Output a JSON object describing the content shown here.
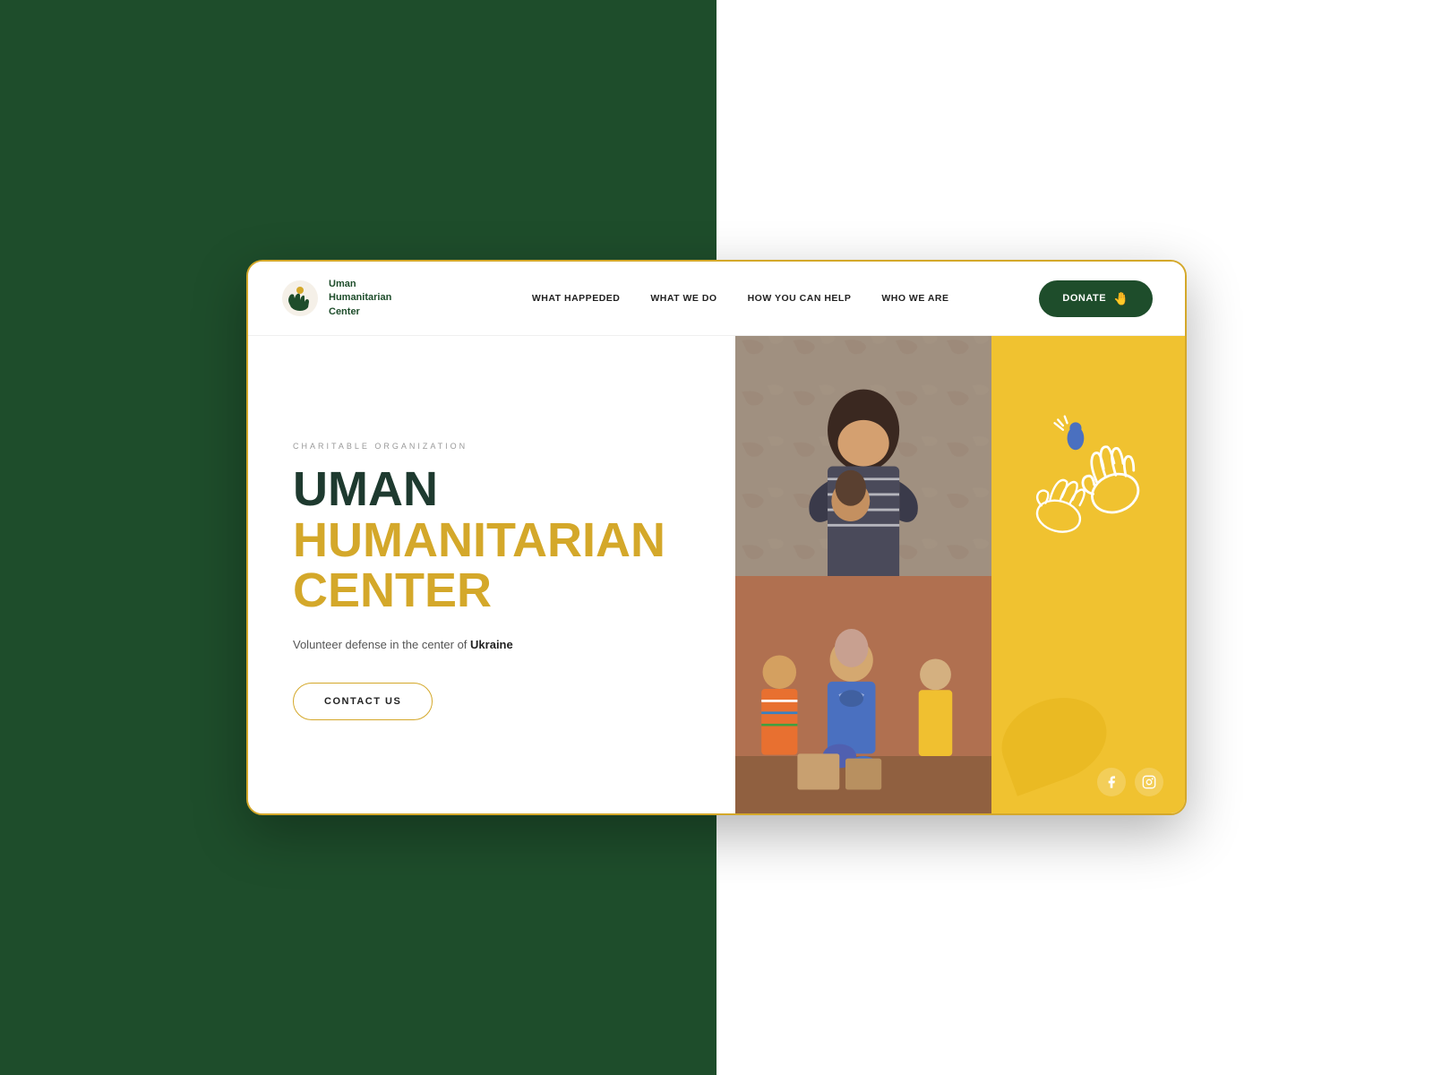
{
  "meta": {
    "bg_left": "#1e4d2b",
    "bg_right": "#ffffff"
  },
  "navbar": {
    "logo_line1": "Uman",
    "logo_line2": "Humanitarian",
    "logo_line3": "Center",
    "nav_items": [
      {
        "id": "what-happened",
        "label": "WHAT HAPPEDED"
      },
      {
        "id": "what-we-do",
        "label": "WHAT WE DO"
      },
      {
        "id": "how-you-can-help",
        "label": "HOW YOU CAN HELP"
      },
      {
        "id": "who-we-are",
        "label": "WHO WE ARE"
      }
    ],
    "donate_label": "DONATE",
    "donate_icon": "🤚"
  },
  "hero": {
    "charity_label": "CHARITABLE ORGANIZATION",
    "title_dark": "UMAN",
    "title_yellow_line1": "HUMANITARIAN",
    "title_yellow_line2": "CENTER",
    "subtitle_plain": "Volunteer defense in the center of ",
    "subtitle_bold": "Ukraine",
    "contact_button": "CONTACT US"
  },
  "yellow_panel": {
    "bg_color": "#f0c230",
    "social": [
      {
        "name": "facebook",
        "icon": "f"
      },
      {
        "name": "instagram",
        "icon": "ig"
      }
    ]
  },
  "colors": {
    "dark_green": "#1e4d2b",
    "yellow": "#d4a82a",
    "bright_yellow": "#f0c230",
    "text_dark": "#1e3a2f"
  }
}
